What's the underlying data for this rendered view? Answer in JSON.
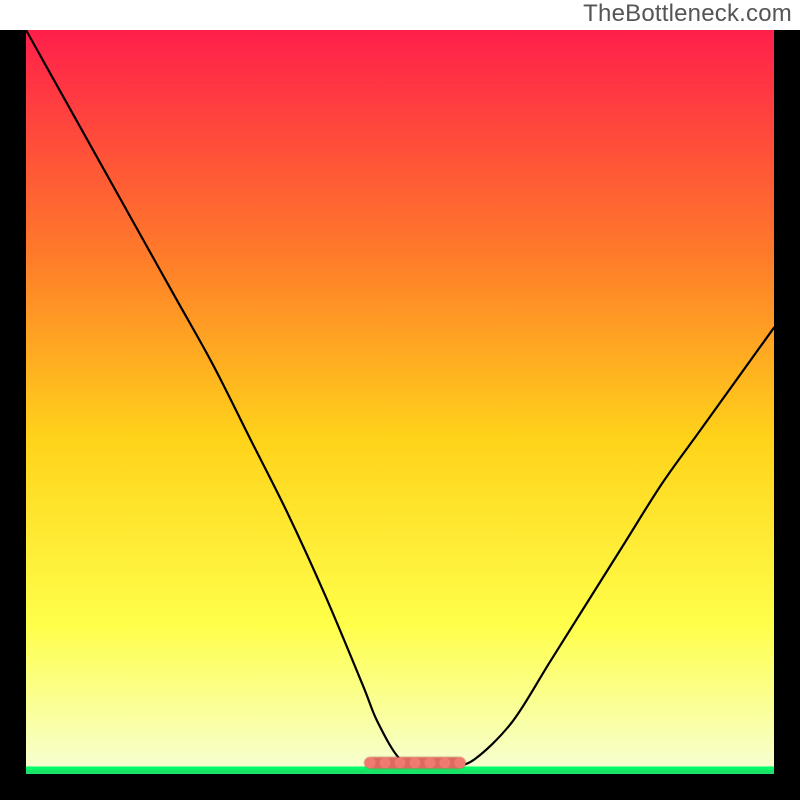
{
  "watermark": "TheBottleneck.com",
  "colors": {
    "frame": "#000000",
    "curve": "#000000",
    "band_fill": "#ef7a6f",
    "band_stroke": "#b84e44",
    "green": "#00e05a",
    "gradient": {
      "top": "#ff1f4b",
      "mid_upper": "#ff7a2a",
      "mid": "#ffd31a",
      "mid_lower": "#ffff4a",
      "bottom": "#f6ffd6"
    }
  },
  "chart_data": {
    "type": "line",
    "title": "",
    "xlabel": "",
    "ylabel": "",
    "xlim": [
      0,
      100
    ],
    "ylim": [
      0,
      100
    ],
    "x": [
      0,
      5,
      10,
      15,
      20,
      25,
      30,
      35,
      40,
      45,
      47,
      50,
      53,
      55,
      57,
      60,
      65,
      70,
      75,
      80,
      85,
      90,
      95,
      100
    ],
    "values": [
      100,
      91,
      82,
      73,
      64,
      55,
      45,
      35,
      24,
      12,
      7,
      2,
      1,
      1,
      1,
      2,
      7,
      15,
      23,
      31,
      39,
      46,
      53,
      60
    ],
    "optimal_band": {
      "x_start": 46,
      "x_end": 58,
      "y": 1.5
    },
    "green_line_y": 0.8
  }
}
